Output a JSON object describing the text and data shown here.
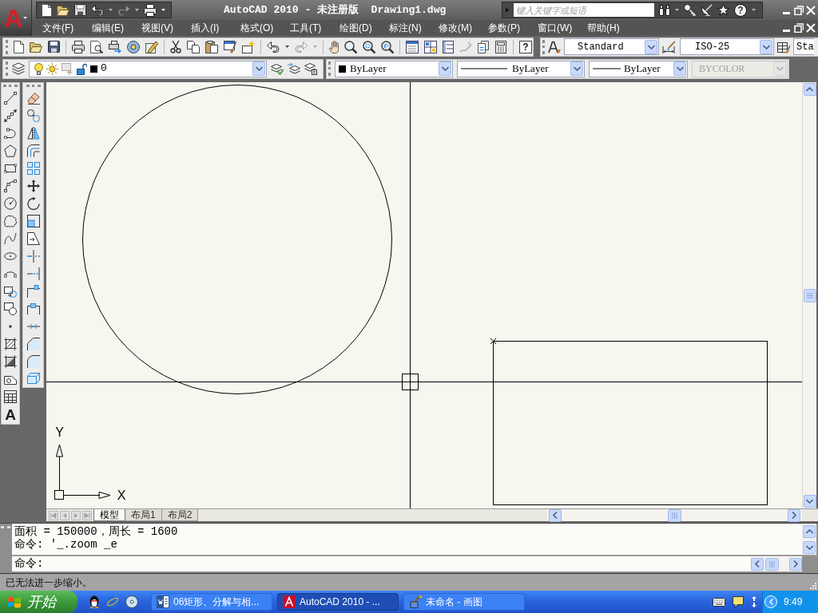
{
  "app_button": {
    "label": "A"
  },
  "title_bar": {
    "title": "AutoCAD 2010 - 未注册版  Drawing1.dwg",
    "search": {
      "placeholder": "键入关键字或短语"
    },
    "help_label": "?"
  },
  "menu_bar": {
    "items": [
      "文件(F)",
      "编辑(E)",
      "视图(V)",
      "插入(I)",
      "格式(O)",
      "工具(T)",
      "绘图(D)",
      "标注(N)",
      "修改(M)",
      "参数(P)",
      "窗口(W)",
      "帮助(H)"
    ]
  },
  "standard_toolbar": {
    "help_label": "?"
  },
  "styles_toolbar": {
    "text_style": "Standard",
    "dimension_style": "ISO-25",
    "table_style": "Sta"
  },
  "layers_toolbar": {
    "current_layer": "0"
  },
  "properties_toolbar": {
    "color_setting": "ByLayer",
    "linetype": "ByLayer",
    "lineweight": "ByLayer",
    "plot_style": {
      "value": "BYCOLOR",
      "disabled": true
    }
  },
  "draw_toolbar": {
    "text_tool_label": "A"
  },
  "drawing": {
    "axis_x_label": "X",
    "axis_y_label": "Y"
  },
  "layout_tabs": [
    {
      "label": "模型",
      "selected": true
    },
    {
      "label": "布局1",
      "selected": false
    },
    {
      "label": "布局2",
      "selected": false
    }
  ],
  "command_window": {
    "history": [
      "面积 = 150000，周长 = 1600",
      "命令: '_.zoom _e"
    ],
    "prompt": "命令:"
  },
  "status_bar": {
    "message": "已无法进一步缩小。"
  },
  "taskbar": {
    "start_label": "开始",
    "tasks": [
      {
        "kind": "document",
        "label": "06矩形、分解与相...",
        "selected": false
      },
      {
        "kind": "cad",
        "label": "AutoCAD 2010 - ...",
        "selected": true
      },
      {
        "kind": "paint",
        "label": "未命名 - 画图",
        "selected": false
      }
    ],
    "clock": "9:49"
  }
}
